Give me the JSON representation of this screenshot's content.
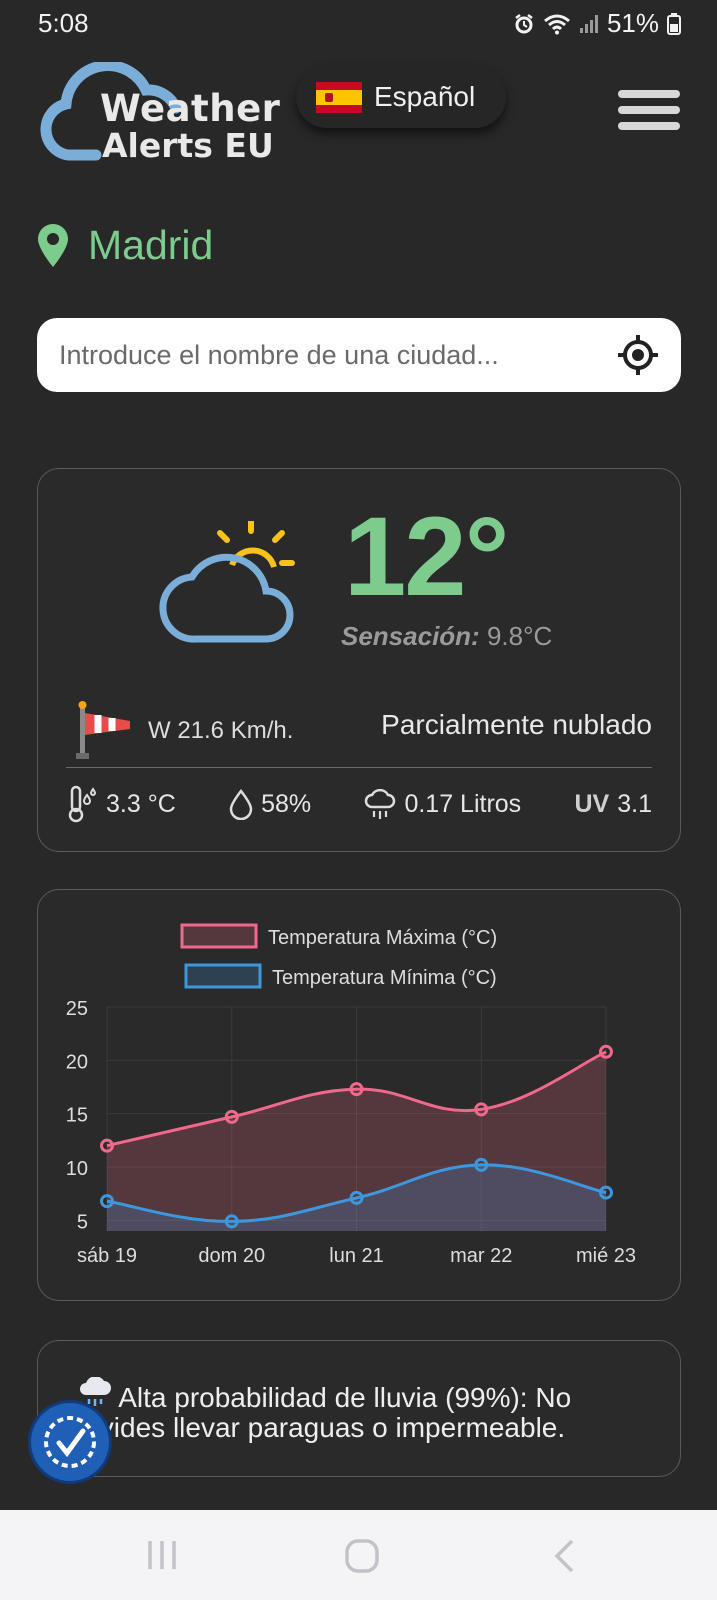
{
  "status": {
    "time": "5:08",
    "battery": "51%"
  },
  "header": {
    "logo_line1": "Weather",
    "logo_line2": "Alerts EU",
    "language_label": "Español"
  },
  "location": {
    "city": "Madrid"
  },
  "search": {
    "placeholder": "Introduce el nombre de una ciudad..."
  },
  "current": {
    "temperature": "12°",
    "feels_label": "Sensación:",
    "feels_value": "9.8°C",
    "wind": "W 21.6 Km/h.",
    "condition": "Parcialmente nublado",
    "dew_point": "3.3 °C",
    "humidity": "58%",
    "precipitation": "0.17 Litros",
    "uv_label": "UV",
    "uv_value": "3.1"
  },
  "alert": {
    "text": "Alta probabilidad de lluvia (99%): No olvides llevar paraguas o impermeable."
  },
  "colors": {
    "accent": "#7dcc8d",
    "max": "#f0698a",
    "min": "#3d97dd",
    "background": "#282828"
  },
  "chart_data": {
    "type": "line",
    "categories": [
      "sáb 19",
      "dom 20",
      "lun 21",
      "mar 22",
      "mié 23"
    ],
    "series": [
      {
        "name": "Temperatura Máxima (°C)",
        "values": [
          12.0,
          14.7,
          17.3,
          15.4,
          20.8
        ],
        "color": "#f0698a"
      },
      {
        "name": "Temperatura Mínima (°C)",
        "values": [
          6.8,
          4.9,
          7.1,
          10.2,
          7.6
        ],
        "color": "#3d97dd"
      }
    ],
    "yticks": [
      5,
      10,
      15,
      20,
      25
    ],
    "ylim": [
      4,
      25
    ],
    "legend": "top",
    "grid": true
  }
}
